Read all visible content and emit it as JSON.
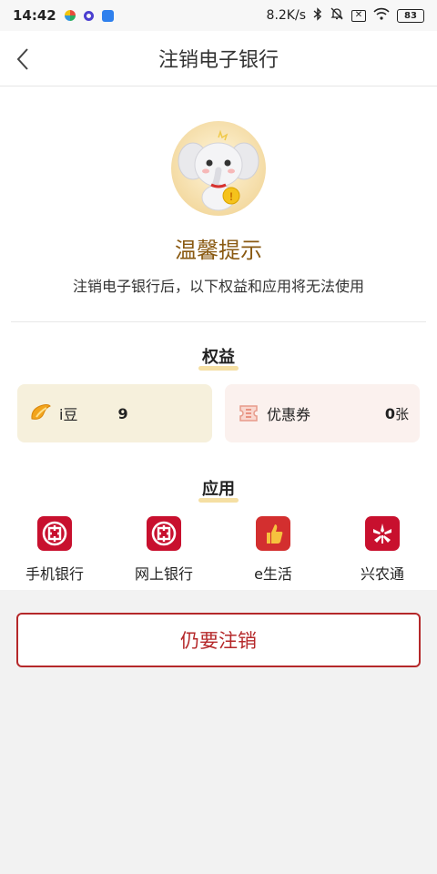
{
  "status_bar": {
    "time": "14:42",
    "network_speed": "8.2K/s",
    "battery": "83"
  },
  "nav": {
    "title": "注销电子银行"
  },
  "notice": {
    "title": "温馨提示",
    "message": "注销电子银行后，以下权益和应用将无法使用"
  },
  "benefits": {
    "section_title": "权益",
    "items": [
      {
        "icon": "ibean-icon",
        "label": "i豆",
        "value": "9",
        "unit": ""
      },
      {
        "icon": "coupon-icon",
        "label": "优惠券",
        "value": "0",
        "unit": "张"
      }
    ]
  },
  "apps": {
    "section_title": "应用",
    "items": [
      {
        "icon": "icbc-logo-icon",
        "label": "手机银行"
      },
      {
        "icon": "icbc-logo-icon",
        "label": "网上银行"
      },
      {
        "icon": "thumbs-up-icon",
        "label": "e生活"
      },
      {
        "icon": "xingnongtong-icon",
        "label": "兴农通"
      }
    ]
  },
  "actions": {
    "confirm_cancel": "仍要注销"
  },
  "colors": {
    "brand_red": "#c8102e",
    "accent_gold": "#8a5a12",
    "button_border": "#b5282a"
  }
}
